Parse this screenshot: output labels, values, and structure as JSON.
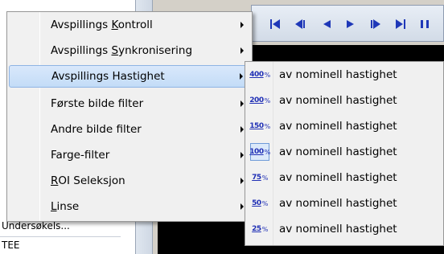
{
  "background": {
    "left_panel_row_1": "Undersøkels...",
    "left_panel_row_2": "TEE"
  },
  "toolbar": {
    "buttons": [
      {
        "icon": "skip-to-start-icon"
      },
      {
        "icon": "step-back-icon"
      },
      {
        "icon": "play-reverse-icon"
      },
      {
        "icon": "play-icon"
      },
      {
        "icon": "step-forward-icon"
      },
      {
        "icon": "skip-to-end-icon"
      },
      {
        "icon": "pause-icon"
      }
    ]
  },
  "menu": {
    "items": [
      {
        "label_pre": "Avspillings ",
        "label_u": "K",
        "label_post": "ontroll",
        "has_submenu": true
      },
      {
        "label_pre": "Avspillings ",
        "label_u": "S",
        "label_post": "ynkronisering",
        "has_submenu": true
      },
      {
        "label_pre": "Avspillings Hastighet",
        "label_u": "",
        "label_post": "",
        "has_submenu": true,
        "highlighted": true
      },
      {
        "label_pre": "Første bilde filter",
        "label_u": "",
        "label_post": "",
        "has_submenu": true
      },
      {
        "label_pre": "Andre bilde filter",
        "label_u": "",
        "label_post": "",
        "has_submenu": true
      },
      {
        "label_pre": "Farge-filter",
        "label_u": "",
        "label_post": "",
        "has_submenu": true
      },
      {
        "label_pre": "",
        "label_u": "R",
        "label_post": "OI Seleksjon",
        "has_submenu": true
      },
      {
        "label_pre": "",
        "label_u": "L",
        "label_post": "inse",
        "has_submenu": true
      }
    ]
  },
  "submenu": {
    "items": [
      {
        "badge": "400",
        "pct": "%",
        "label": "av nominell hastighet",
        "checked": false
      },
      {
        "badge": "200",
        "pct": "%",
        "label": "av nominell hastighet",
        "checked": false
      },
      {
        "badge": "150",
        "pct": "%",
        "label": "av nominell hastighet",
        "checked": false
      },
      {
        "badge": "100",
        "pct": "%",
        "label": "av nominell hastighet",
        "checked": true
      },
      {
        "badge": "75",
        "pct": "%",
        "label": "av nominell hastighet",
        "checked": false
      },
      {
        "badge": "50",
        "pct": "%",
        "label": "av nominell hastighet",
        "checked": false
      },
      {
        "badge": "25",
        "pct": "%",
        "label": "av nominell hastighet",
        "checked": false
      }
    ]
  },
  "colors": {
    "accent_blue": "#1f38b8",
    "highlight": "#c3dcf7"
  }
}
